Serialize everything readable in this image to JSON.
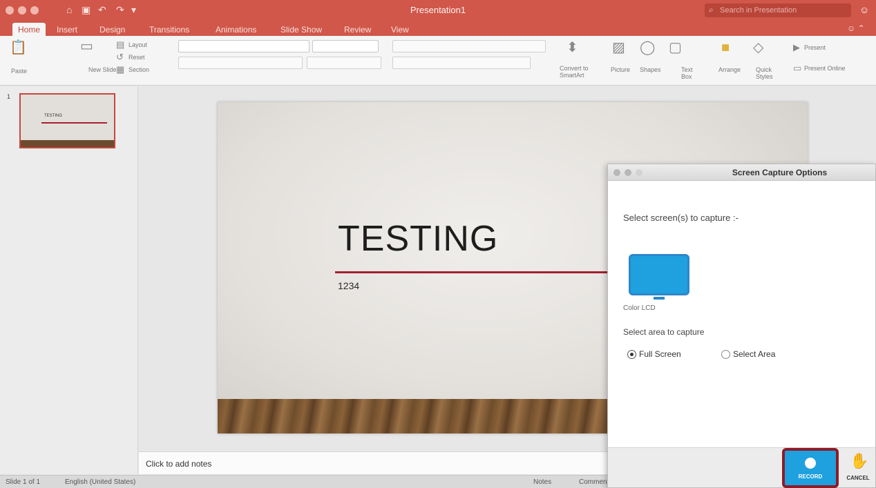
{
  "titlebar": {
    "doc_title": "Presentation1",
    "search_placeholder": "Search in Presentation",
    "undo_icon": "undo-icon",
    "redo_icon": "redo-icon"
  },
  "tabs": [
    {
      "label": "Home",
      "active": true
    },
    {
      "label": "Insert"
    },
    {
      "label": "Design"
    },
    {
      "label": "Transitions"
    },
    {
      "label": "Animations"
    },
    {
      "label": "Slide Show"
    },
    {
      "label": "Review"
    },
    {
      "label": "View"
    }
  ],
  "ribbon": {
    "paste": "Paste",
    "new_slide": "New Slide",
    "layout": "Layout",
    "reset": "Reset",
    "section": "Section",
    "convert_smartart": "Convert to SmartArt",
    "picture": "Picture",
    "shapes": "Shapes",
    "text_box": "Text Box",
    "arrange": "Arrange",
    "quick_styles": "Quick Styles",
    "present": "Present",
    "present_online": "Present Online"
  },
  "thumbnails": {
    "number": "1",
    "mini_title": "TESTING"
  },
  "slide": {
    "title": "TESTING",
    "subtitle": "1234"
  },
  "notes": {
    "placeholder": "Click to add notes"
  },
  "status": {
    "slide_of": "Slide 1 of 1",
    "language": "English (United States)",
    "notes": "Notes",
    "comments": "Comments"
  },
  "dialog": {
    "title": "Screen Capture Options",
    "select_screens": "Select screen(s) to capture :-",
    "monitor_label": "Color LCD",
    "select_area": "Select area to capture",
    "full_screen": "Full Screen",
    "select_area_option": "Select Area",
    "record": "RECORD",
    "cancel": "CANCEL",
    "selected_option": "Full Screen",
    "accent_color": "#1ea1de",
    "highlight_color": "#8e1b26"
  },
  "colors": {
    "app_accent": "#d0574a",
    "slide_rule": "#a51f2f"
  }
}
